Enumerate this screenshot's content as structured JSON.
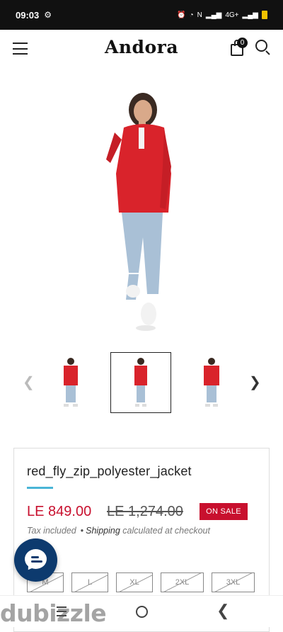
{
  "status_bar": {
    "time": "09:03",
    "network": "4G+"
  },
  "header": {
    "brand": "Andora",
    "cart_count": "0"
  },
  "gallery": {
    "prev_icon": "chevron-left-icon",
    "next_icon": "chevron-right-icon",
    "thumbnail_count": 3,
    "active_index": 1
  },
  "product": {
    "title": "red_fly_zip_polyester_jacket",
    "price": "LE 849.00",
    "compare_price": "LE 1,274.00",
    "sale_badge": "ON SALE",
    "tax_included": "Tax included",
    "bullet": "•",
    "shipping_label": "Shipping",
    "shipping_suffix": "calculated at checkout",
    "sizes": [
      "M",
      "L",
      "XL",
      "2XL",
      "3XL"
    ]
  },
  "colors": {
    "accent": "#49b5d6",
    "price": "#c8102e",
    "sale_badge_bg": "#c8102e",
    "chat_button": "#0d3a6e",
    "jacket": "#d9232b",
    "jeans": "#a9c0d6"
  },
  "watermark": {
    "text": "dubizzle"
  }
}
